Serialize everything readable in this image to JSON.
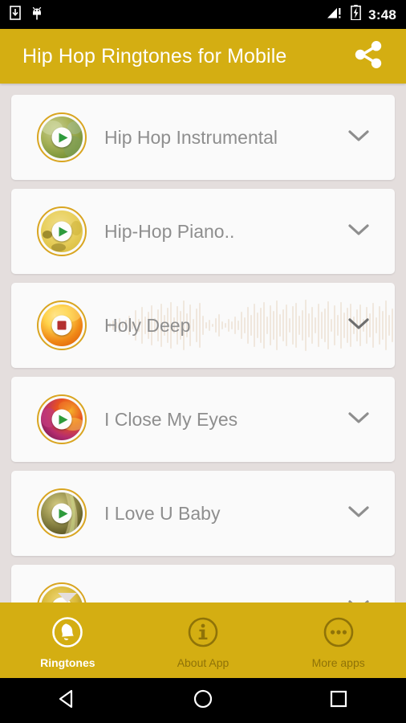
{
  "status_bar": {
    "time": "3:48",
    "icons": [
      "download-icon",
      "android-bug-icon",
      "signal-no-service-icon",
      "battery-charging-icon"
    ],
    "background": "#000000",
    "foreground": "#FFFFFF"
  },
  "app_bar": {
    "title": "Hip Hop Ringtones for Mobile",
    "share_icon": "share-icon",
    "background": "#D4AE12",
    "title_color": "#FFFFFF"
  },
  "list": {
    "background": "#E4DEDD",
    "card_background": "#FAFAFA",
    "title_color": "#8E8E8E",
    "ring_color": "#D9A520",
    "items": [
      {
        "title": "Hip Hop Instrumental",
        "state": "stopped",
        "button_icon": "play-icon",
        "expand_icon": "chevron-down-icon",
        "art_colors": [
          "#A9B35A",
          "#6E8C2F",
          "#C6CE94",
          "#7FA05B"
        ]
      },
      {
        "title": "Hip-Hop Piano..",
        "state": "stopped",
        "button_icon": "play-icon",
        "expand_icon": "chevron-down-icon",
        "art_colors": [
          "#E8CF5C",
          "#D9BC3E",
          "#8C7A22",
          "#F0DE8A"
        ]
      },
      {
        "title": "Holy Deep",
        "state": "playing",
        "button_icon": "stop-icon",
        "expand_icon": "chevron-down-icon",
        "art_colors": [
          "#FFD24A",
          "#F08A18",
          "#E2650C",
          "#FFE89A"
        ],
        "waveform": true
      },
      {
        "title": "I Close My Eyes",
        "state": "stopped",
        "button_icon": "play-icon",
        "expand_icon": "chevron-down-icon",
        "art_colors": [
          "#B52C6E",
          "#E8531F",
          "#F5B32A",
          "#7D1C55"
        ]
      },
      {
        "title": "I Love U Baby",
        "state": "stopped",
        "button_icon": "play-icon",
        "expand_icon": "chevron-down-icon",
        "art_colors": [
          "#9A9450",
          "#6B6324",
          "#D8CE86",
          "#4C4718"
        ]
      },
      {
        "title": "",
        "state": "stopped",
        "button_icon": "play-icon",
        "expand_icon": "chevron-down-icon",
        "art_colors": [
          "#D9B93A",
          "#BE9A1E",
          "#EFD87A",
          "#8C7316"
        ],
        "partial": true
      }
    ]
  },
  "bottom_nav": {
    "background": "#D4AE12",
    "active_color": "#FFFFFF",
    "inactive_color": "#8F7308",
    "items": [
      {
        "label": "Ringtones",
        "icon": "bell-icon",
        "active": true
      },
      {
        "label": "About App",
        "icon": "info-icon",
        "active": false
      },
      {
        "label": "More apps",
        "icon": "more-dots-icon",
        "active": false
      }
    ]
  },
  "system_nav": {
    "background": "#000000",
    "buttons": [
      {
        "name": "back-button",
        "icon": "triangle-left-icon"
      },
      {
        "name": "home-button",
        "icon": "circle-icon"
      },
      {
        "name": "recents-button",
        "icon": "square-icon"
      }
    ]
  }
}
